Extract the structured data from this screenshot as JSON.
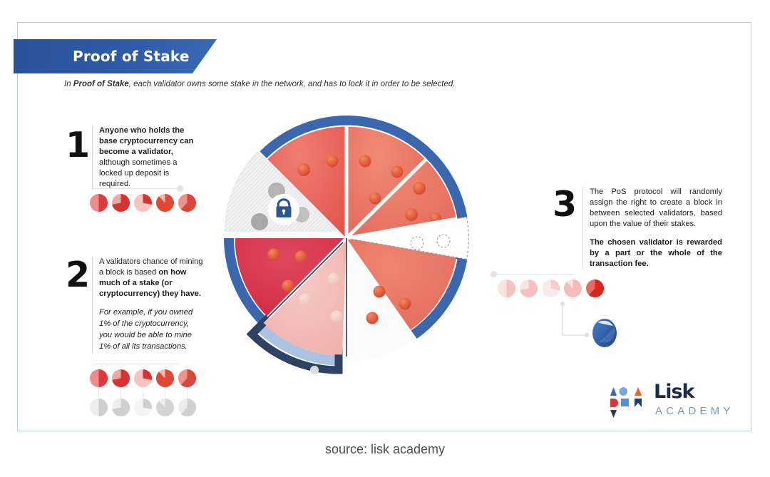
{
  "banner": {
    "title": "Proof of Stake"
  },
  "subtitle": {
    "lead": "In ",
    "bold": "Proof of Stake",
    "rest": ", each validator owns some stake in the network, and has to lock it in order to be selected."
  },
  "steps": [
    {
      "number": "1",
      "bold": "Anyone who holds the base cryptocurrency can become a validator,",
      "normal": " although sometimes a locked up deposit is required.",
      "italic": ""
    },
    {
      "number": "2",
      "normal": "A validators chance of mining a block is based ",
      "bold": "on how much of a stake (or cryptocurrency) they have.",
      "italic": "For example, if you owned 1% of the cryptocurrency, you would be able to mine 1% of all its transactions."
    },
    {
      "number": "3",
      "normal": "The PoS protocol will randomly assign the right to create a block in between selected validators, based upon the value of their stakes.",
      "bold": "The chosen validator is rewarded by a part or the whole of the transaction fee.",
      "italic": ""
    }
  ],
  "diagram": {
    "name": "proof-of-stake-pizza-chart",
    "lock_icon": "lock-icon",
    "slices": [
      {
        "id": "slice-top-right-a",
        "start": -90,
        "end": -45,
        "fill": "#e8635c",
        "state": "filled"
      },
      {
        "id": "slice-top-right-b",
        "start": -45,
        "end": -10,
        "fill": "#e8685a",
        "state": "filled"
      },
      {
        "id": "slice-right-empty",
        "start": -10,
        "end": 55,
        "fill": "#ffffff",
        "state": "dashed-empty"
      },
      {
        "id": "slice-bottom-right",
        "start": 55,
        "end": 90,
        "fill": "#e87060",
        "state": "filled"
      },
      {
        "id": "slice-bottom-center",
        "start": 90,
        "end": 135,
        "fill": "#f2b3ae",
        "state": "faded"
      },
      {
        "id": "slice-bottom-left",
        "start": 135,
        "end": 180,
        "fill": "#d8384f",
        "state": "filled"
      },
      {
        "id": "slice-left-locked",
        "start": 180,
        "end": 225,
        "fill": "#efefef",
        "state": "hatched-locked"
      },
      {
        "id": "slice-top-left",
        "start": 225,
        "end": 270,
        "fill": "#e4544f",
        "state": "filled"
      }
    ],
    "ring_colors": {
      "crust": "#3a67ad",
      "crust_dark": "#2b4f86",
      "crust_light": "#aac3e2",
      "crust_navy": "#2e4263"
    }
  },
  "pie_rows": {
    "step1": [
      {
        "id": "p1",
        "pct": 50,
        "fill": "#dd3b3b",
        "bg": "#f08a8a"
      },
      {
        "id": "p2",
        "pct": 72,
        "fill": "#d8342f",
        "bg": "#f4a7a2"
      },
      {
        "id": "p3",
        "pct": 28,
        "fill": "#d8342f",
        "bg": "#f7c4c0"
      },
      {
        "id": "p4",
        "pct": 88,
        "fill": "#e04a35",
        "bg": "#f6b5ad"
      },
      {
        "id": "p5",
        "pct": 62,
        "fill": "#d9483f",
        "bg": "#ef9287"
      }
    ],
    "step2_top": [
      {
        "id": "q1",
        "pct": 50,
        "fill": "#dd3b3b",
        "bg": "#f08a8a"
      },
      {
        "id": "q2",
        "pct": 72,
        "fill": "#d8342f",
        "bg": "#f4a7a2"
      },
      {
        "id": "q3",
        "pct": 28,
        "fill": "#d8342f",
        "bg": "#f7c4c0"
      },
      {
        "id": "q4",
        "pct": 88,
        "fill": "#e04a35",
        "bg": "#f6b5ad"
      },
      {
        "id": "q5",
        "pct": 62,
        "fill": "#d9483f",
        "bg": "#ef9287"
      }
    ],
    "step2_bottom": [
      {
        "id": "g1",
        "pct": 50,
        "fill": "#cfcfcf",
        "bg": "#eeeeee"
      },
      {
        "id": "g2",
        "pct": 72,
        "fill": "#cfcfcf",
        "bg": "#eeeeee"
      },
      {
        "id": "g3",
        "pct": 28,
        "fill": "#cfcfcf",
        "bg": "#f4f4f4"
      },
      {
        "id": "g4",
        "pct": 88,
        "fill": "#d4d4d4",
        "bg": "#ededed"
      },
      {
        "id": "g5",
        "pct": 62,
        "fill": "#d0d0d0",
        "bg": "#ececec"
      }
    ],
    "step3": [
      {
        "id": "r1",
        "pct": 50,
        "fill": "#f3c2bd",
        "bg": "#fae3e1"
      },
      {
        "id": "r2",
        "pct": 72,
        "fill": "#f3c2bd",
        "bg": "#fae3e1"
      },
      {
        "id": "r3",
        "pct": 28,
        "fill": "#f5cdc9",
        "bg": "#fbe9e7"
      },
      {
        "id": "r4",
        "pct": 88,
        "fill": "#f2bdb8",
        "bg": "#fae3e1"
      },
      {
        "id": "r5",
        "pct": 62,
        "fill": "#d8261d",
        "bg": "#e8695e",
        "selected": true
      }
    ]
  },
  "selected_block": {
    "name": "blue-block-shape",
    "color": "#2f5fa8"
  },
  "logo": {
    "word": "Lisk",
    "sub": "ACADEMY"
  },
  "source": {
    "text": "source: lisk academy"
  }
}
